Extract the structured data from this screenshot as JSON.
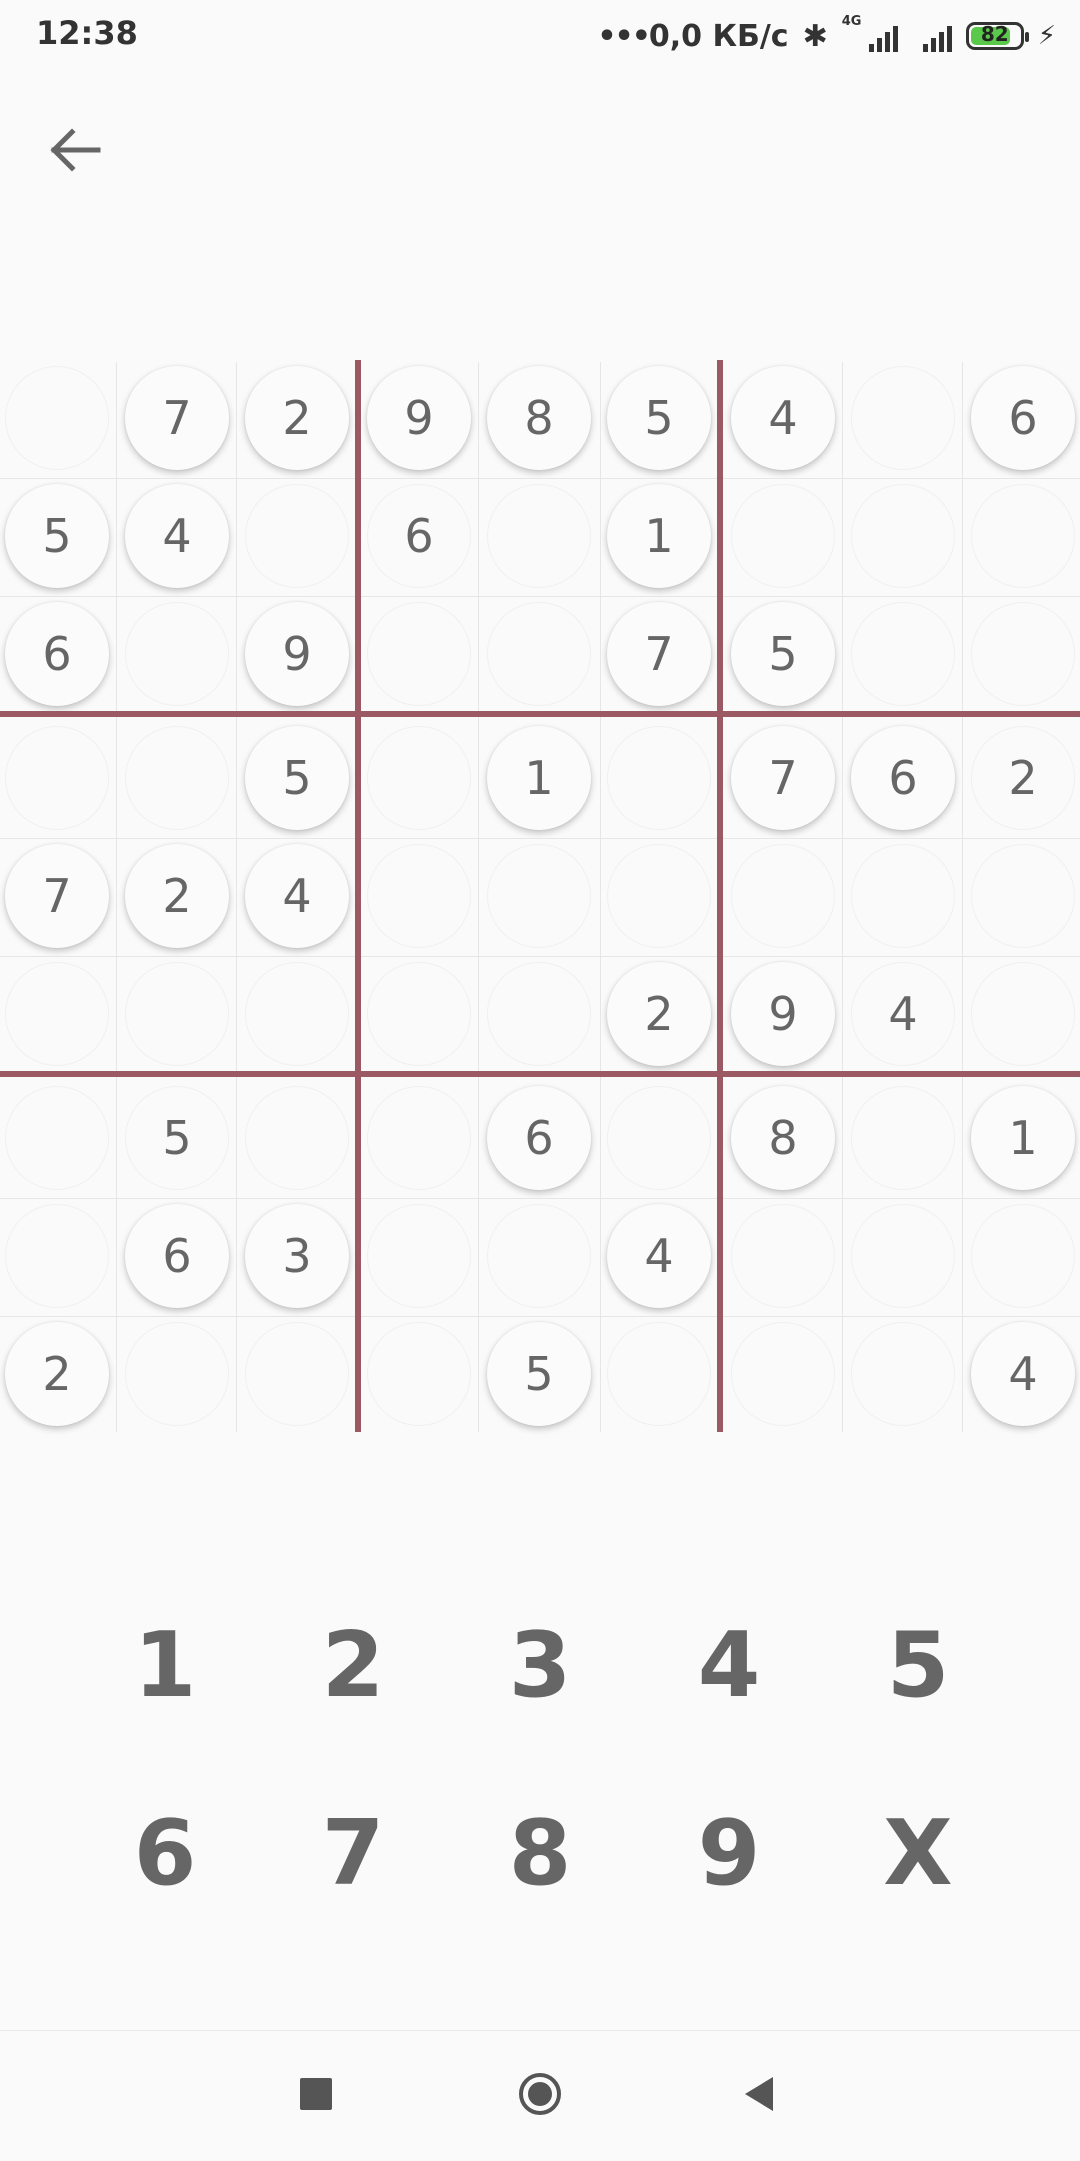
{
  "status_bar": {
    "time": "12:38",
    "dots": "•••",
    "net_speed": "0,0 КБ/с",
    "network_type": "4G",
    "battery_level": "82",
    "battery_fraction": 0.82,
    "icons": [
      "bluetooth-icon",
      "signal-icon",
      "signal-icon",
      "battery-icon",
      "charging-icon"
    ]
  },
  "header": {
    "back_icon": "arrow-left-icon"
  },
  "colors": {
    "block_divider": "#9b5a63",
    "digit": "#666666",
    "battery_fill": "#5ac84a"
  },
  "board": {
    "rows": [
      [
        "",
        "7",
        "2",
        "9",
        "8",
        "5",
        "4",
        "",
        "6"
      ],
      [
        "5",
        "4",
        "",
        "6",
        "",
        "1",
        "",
        "",
        ""
      ],
      [
        "6",
        "",
        "9",
        "",
        "",
        "7",
        "5",
        "",
        ""
      ],
      [
        "",
        "",
        "5",
        "",
        "1",
        "",
        "7",
        "6",
        "2"
      ],
      [
        "7",
        "2",
        "4",
        "",
        "",
        "",
        "",
        "",
        ""
      ],
      [
        "",
        "",
        "",
        "",
        "",
        "2",
        "9",
        "4",
        ""
      ],
      [
        "",
        "5",
        "",
        "",
        "6",
        "",
        "8",
        "",
        "1"
      ],
      [
        "",
        "6",
        "3",
        "",
        "",
        "4",
        "",
        "",
        ""
      ],
      [
        "2",
        "",
        "",
        "",
        "5",
        "",
        "",
        "",
        "4"
      ]
    ],
    "circled": [
      [
        false,
        true,
        true,
        true,
        true,
        true,
        true,
        false,
        true
      ],
      [
        true,
        true,
        false,
        false,
        false,
        true,
        false,
        false,
        false
      ],
      [
        true,
        false,
        true,
        false,
        false,
        true,
        true,
        false,
        false
      ],
      [
        false,
        false,
        true,
        false,
        true,
        false,
        true,
        true,
        false
      ],
      [
        true,
        true,
        true,
        false,
        false,
        false,
        false,
        false,
        false
      ],
      [
        false,
        false,
        false,
        false,
        false,
        true,
        true,
        false,
        false
      ],
      [
        false,
        false,
        false,
        false,
        true,
        false,
        true,
        false,
        true
      ],
      [
        false,
        true,
        true,
        false,
        false,
        true,
        false,
        false,
        false
      ],
      [
        true,
        false,
        false,
        false,
        true,
        false,
        false,
        false,
        true
      ]
    ]
  },
  "keypad": {
    "keys": [
      "1",
      "2",
      "3",
      "4",
      "5",
      "6",
      "7",
      "8",
      "9",
      "X"
    ]
  },
  "nav_bar": {
    "icons": [
      "recent-apps-icon",
      "home-icon",
      "back-icon"
    ]
  }
}
